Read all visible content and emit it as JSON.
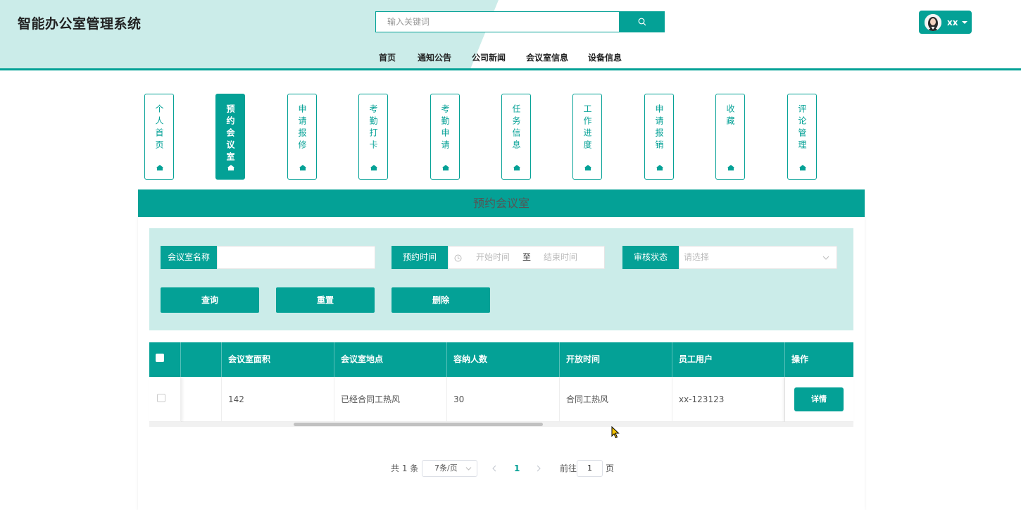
{
  "app": {
    "title": "智能办公室管理系统"
  },
  "search": {
    "placeholder": "输入关键词"
  },
  "user": {
    "name": "xx"
  },
  "top_nav": [
    "首页",
    "通知公告",
    "公司新闻",
    "会议室信息",
    "设备信息"
  ],
  "side_menu": [
    {
      "label": "个人首页",
      "active": false
    },
    {
      "label": "预约会议室",
      "active": true
    },
    {
      "label": "申请报修",
      "active": false
    },
    {
      "label": "考勤打卡",
      "active": false
    },
    {
      "label": "考勤申请",
      "active": false
    },
    {
      "label": "任务信息",
      "active": false
    },
    {
      "label": "工作进度",
      "active": false
    },
    {
      "label": "申请报销",
      "active": false
    },
    {
      "label": "收藏",
      "active": false
    },
    {
      "label": "评论管理",
      "active": false
    }
  ],
  "section_title": "预约会议室",
  "filters": {
    "room_name_label": "会议室名称",
    "time_label": "预约时间",
    "start_placeholder": "开始时间",
    "range_sep": "至",
    "end_placeholder": "结束时间",
    "status_label": "审核状态",
    "status_placeholder": "请选择"
  },
  "buttons": {
    "query": "查询",
    "reset": "重置",
    "delete": "删除",
    "detail": "详情"
  },
  "table": {
    "headers": [
      "会议室面积",
      "会议室地点",
      "容纳人数",
      "开放时间",
      "员工用户",
      "操作"
    ],
    "rows": [
      {
        "area": "142",
        "location": "已经合同工热风",
        "capacity": "30",
        "open_time": "合同工热风",
        "employee": "xx-123123"
      }
    ]
  },
  "pagination": {
    "total": "共 1 条",
    "page_size": "7条/页",
    "current_page": "1",
    "goto_label": "前往",
    "goto_value": "1",
    "page_suffix": "页"
  },
  "colors": {
    "accent": "#04a196",
    "header_tint": "#cbece9",
    "filter_bg": "#cbece9"
  }
}
